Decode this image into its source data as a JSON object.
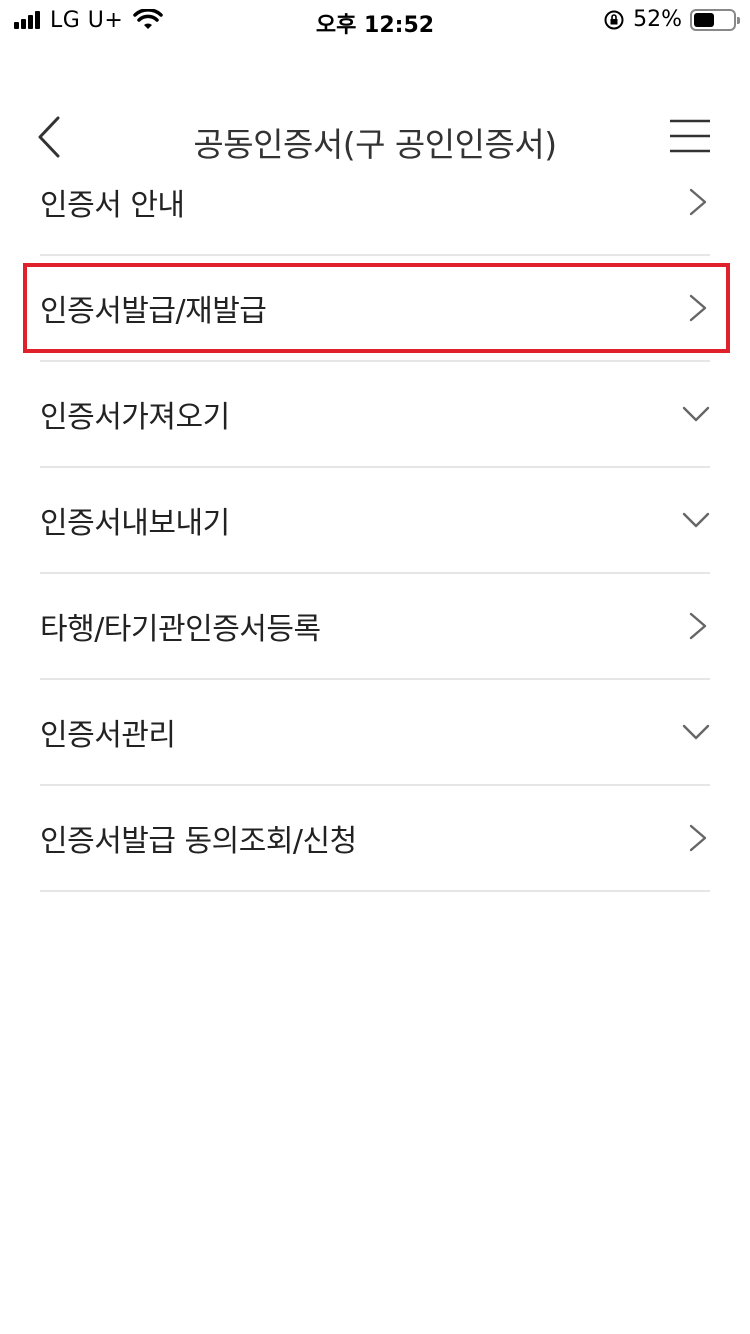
{
  "status_bar": {
    "carrier": "LG U+",
    "time": "오후 12:52",
    "battery_percent": "52%",
    "battery_level": 0.52,
    "icons": [
      "cellular-signal-icon",
      "wifi-icon",
      "orientation-lock-icon",
      "battery-icon"
    ]
  },
  "nav": {
    "title": "공동인증서(구 공인인증서)",
    "back_icon": "chevron-left-icon",
    "menu_icon": "hamburger-menu-icon"
  },
  "menu": {
    "items": [
      {
        "label": "인증서 안내",
        "icon": "chevron-right-icon"
      },
      {
        "label": "인증서발급/재발급",
        "icon": "chevron-right-icon",
        "highlighted": true
      },
      {
        "label": "인증서가져오기",
        "icon": "chevron-down-icon"
      },
      {
        "label": "인증서내보내기",
        "icon": "chevron-down-icon"
      },
      {
        "label": "타행/타기관인증서등록",
        "icon": "chevron-right-icon"
      },
      {
        "label": "인증서관리",
        "icon": "chevron-down-icon"
      },
      {
        "label": "인증서발급 동의조회/신청",
        "icon": "chevron-right-icon"
      }
    ]
  },
  "colors": {
    "highlight": "#e0202a",
    "divider": "#e6e6e6",
    "text": "#222222"
  }
}
